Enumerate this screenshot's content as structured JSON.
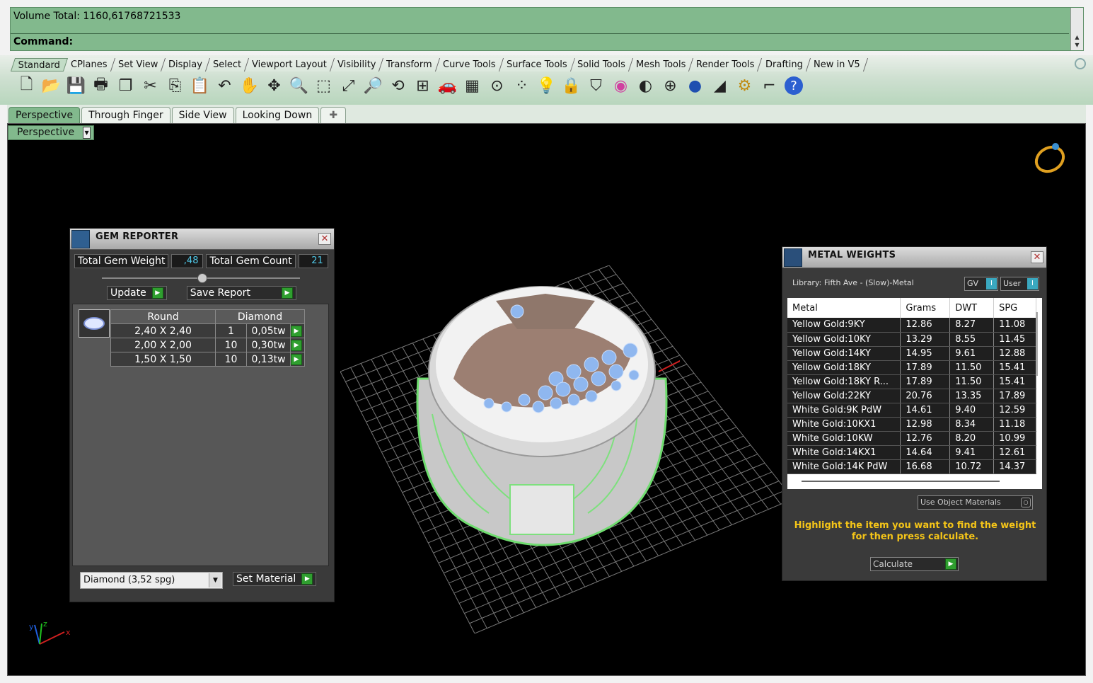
{
  "command": {
    "output_line": "Volume Total: 1160,61768721533",
    "prompt": "Command:"
  },
  "toolbar_tabs": [
    "Standard",
    "CPlanes",
    "Set View",
    "Display",
    "Select",
    "Viewport Layout",
    "Visibility",
    "Transform",
    "Curve Tools",
    "Surface Tools",
    "Solid Tools",
    "Mesh Tools",
    "Render Tools",
    "Drafting",
    "New in V5"
  ],
  "toolbar_icons": [
    "new-file",
    "open-folder",
    "save",
    "print",
    "copy-doc",
    "cut",
    "copy",
    "paste",
    "undo",
    "pan-hand",
    "move",
    "zoom",
    "zoom-window",
    "zoom-extents",
    "zoom-selected",
    "rotate-view",
    "four-viewports",
    "car-object",
    "grid-plane",
    "circle-snap",
    "points",
    "light-bulb",
    "lock",
    "layer-shield",
    "color-wheel",
    "sphere-shade",
    "sphere-grid",
    "render-sphere",
    "sweep",
    "gear-settings",
    "dimension",
    "help"
  ],
  "viewport_tabs": [
    "Perspective",
    "Through Finger",
    "Side View",
    "Looking Down"
  ],
  "viewport_label": "Perspective",
  "axes": {
    "x": "x",
    "y": "y",
    "z": "z"
  },
  "gem_reporter": {
    "title": "GEM REPORTER",
    "total_weight_label": "Total Gem Weight",
    "total_weight_value": ",48",
    "total_count_label": "Total Gem Count",
    "total_count_value": "21",
    "update_label": "Update",
    "save_report_label": "Save Report",
    "table_header": [
      "Round",
      "Diamond"
    ],
    "rows": [
      {
        "size": "2,40 X 2,40",
        "count": "1",
        "weight": "0,05tw"
      },
      {
        "size": "2,00 X 2,00",
        "count": "10",
        "weight": "0,30tw"
      },
      {
        "size": "1,50 X 1,50",
        "count": "10",
        "weight": "0,13tw"
      }
    ],
    "material_select": "Diamond    (3,52 spg)",
    "set_material_label": "Set Material"
  },
  "metal_weights": {
    "title": "METAL WEIGHTS",
    "library": "Library: Fifth Ave - (Slow)-Metal",
    "gv_label": "GV",
    "user_label": "User",
    "columns": [
      "Metal",
      "Grams",
      "DWT",
      "SPG"
    ],
    "rows": [
      [
        "Yellow Gold:9KY",
        "12.86",
        "8.27",
        "11.08"
      ],
      [
        "Yellow Gold:10KY",
        "13.29",
        "8.55",
        "11.45"
      ],
      [
        "Yellow Gold:14KY",
        "14.95",
        "9.61",
        "12.88"
      ],
      [
        "Yellow Gold:18KY",
        "17.89",
        "11.50",
        "15.41"
      ],
      [
        "Yellow Gold:18KY R...",
        "17.89",
        "11.50",
        "15.41"
      ],
      [
        "Yellow Gold:22KY",
        "20.76",
        "13.35",
        "17.89"
      ],
      [
        "White Gold:9K PdW",
        "14.61",
        "9.40",
        "12.59"
      ],
      [
        "White Gold:10KX1",
        "12.98",
        "8.34",
        "11.18"
      ],
      [
        "White Gold:10KW",
        "12.76",
        "8.20",
        "10.99"
      ],
      [
        "White Gold:14KX1",
        "14.64",
        "9.41",
        "12.61"
      ],
      [
        "White Gold:14K PdW",
        "16.68",
        "10.72",
        "14.37"
      ]
    ],
    "use_object_materials": "Use Object Materials",
    "hint": "Highlight the item you want to find the weight for then press calculate.",
    "calculate_label": "Calculate"
  },
  "colors": {
    "command_bg": "#82b98d",
    "panel_bg": "#3a3a3a",
    "hint": "#f5c518",
    "accent_value": "#4fc8e8"
  }
}
